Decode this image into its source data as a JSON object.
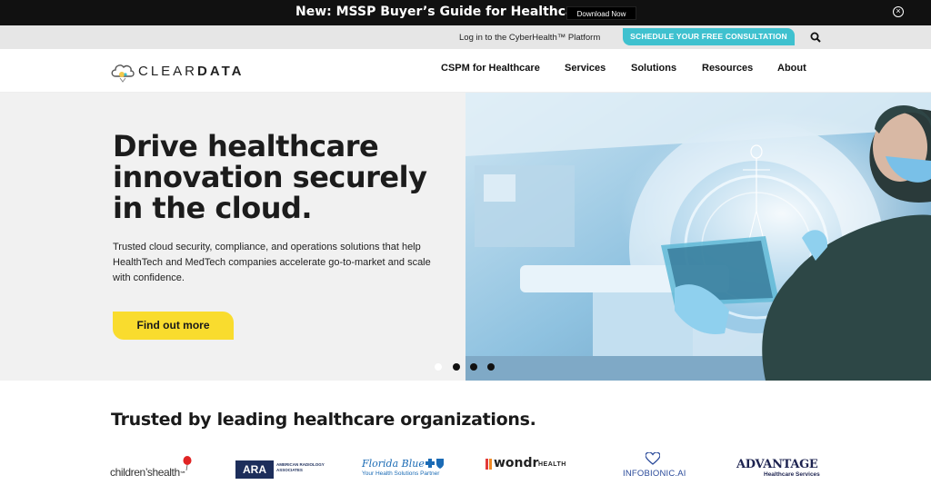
{
  "announcement": {
    "text": "New: MSSP Buyer’s Guide for Healthcare",
    "button_label": "Download Now",
    "close_glyph": "⊗"
  },
  "utility": {
    "login_link": "Log in to the CyberHealth™ Platform",
    "cta_label": "SCHEDULE YOUR FREE CONSULTATION",
    "search_icon": "search-icon"
  },
  "nav": {
    "logo_part1": "CLEAR",
    "logo_part2": "DATA",
    "items": [
      {
        "label": "CSPM for Healthcare"
      },
      {
        "label": "Services"
      },
      {
        "label": "Solutions"
      },
      {
        "label": "Resources"
      },
      {
        "label": "About"
      }
    ]
  },
  "hero": {
    "title_lines": [
      "Drive healthcare",
      "innovation securely",
      "in the cloud."
    ],
    "description": "Trusted cloud security, compliance, and operations solutions that help HealthTech and MedTech companies accelerate go-to-market and scale with confidence.",
    "cta_label": "Find out more",
    "carousel": {
      "total": 4,
      "active": 1
    }
  },
  "trusted": {
    "title": "Trusted by leading healthcare organizations.",
    "partners": [
      {
        "name": "children’shealth",
        "suffix": "℠"
      },
      {
        "name": "ARA",
        "sub1": "AMERICAN RADIOLOGY",
        "sub2": "ASSOCIATES"
      },
      {
        "name": "Florida Blue",
        "sub": "Your Health Solutions Partner"
      },
      {
        "name": "wondr",
        "suffix": "HEALTH"
      },
      {
        "name": "INFOBIONIC.AI"
      },
      {
        "name": "ADVANTAGE",
        "sub": "Healthcare Services"
      }
    ]
  },
  "colors": {
    "accent_teal": "#3fc1cf",
    "accent_yellow": "#f9dc2e",
    "announce_bg": "#111111"
  }
}
